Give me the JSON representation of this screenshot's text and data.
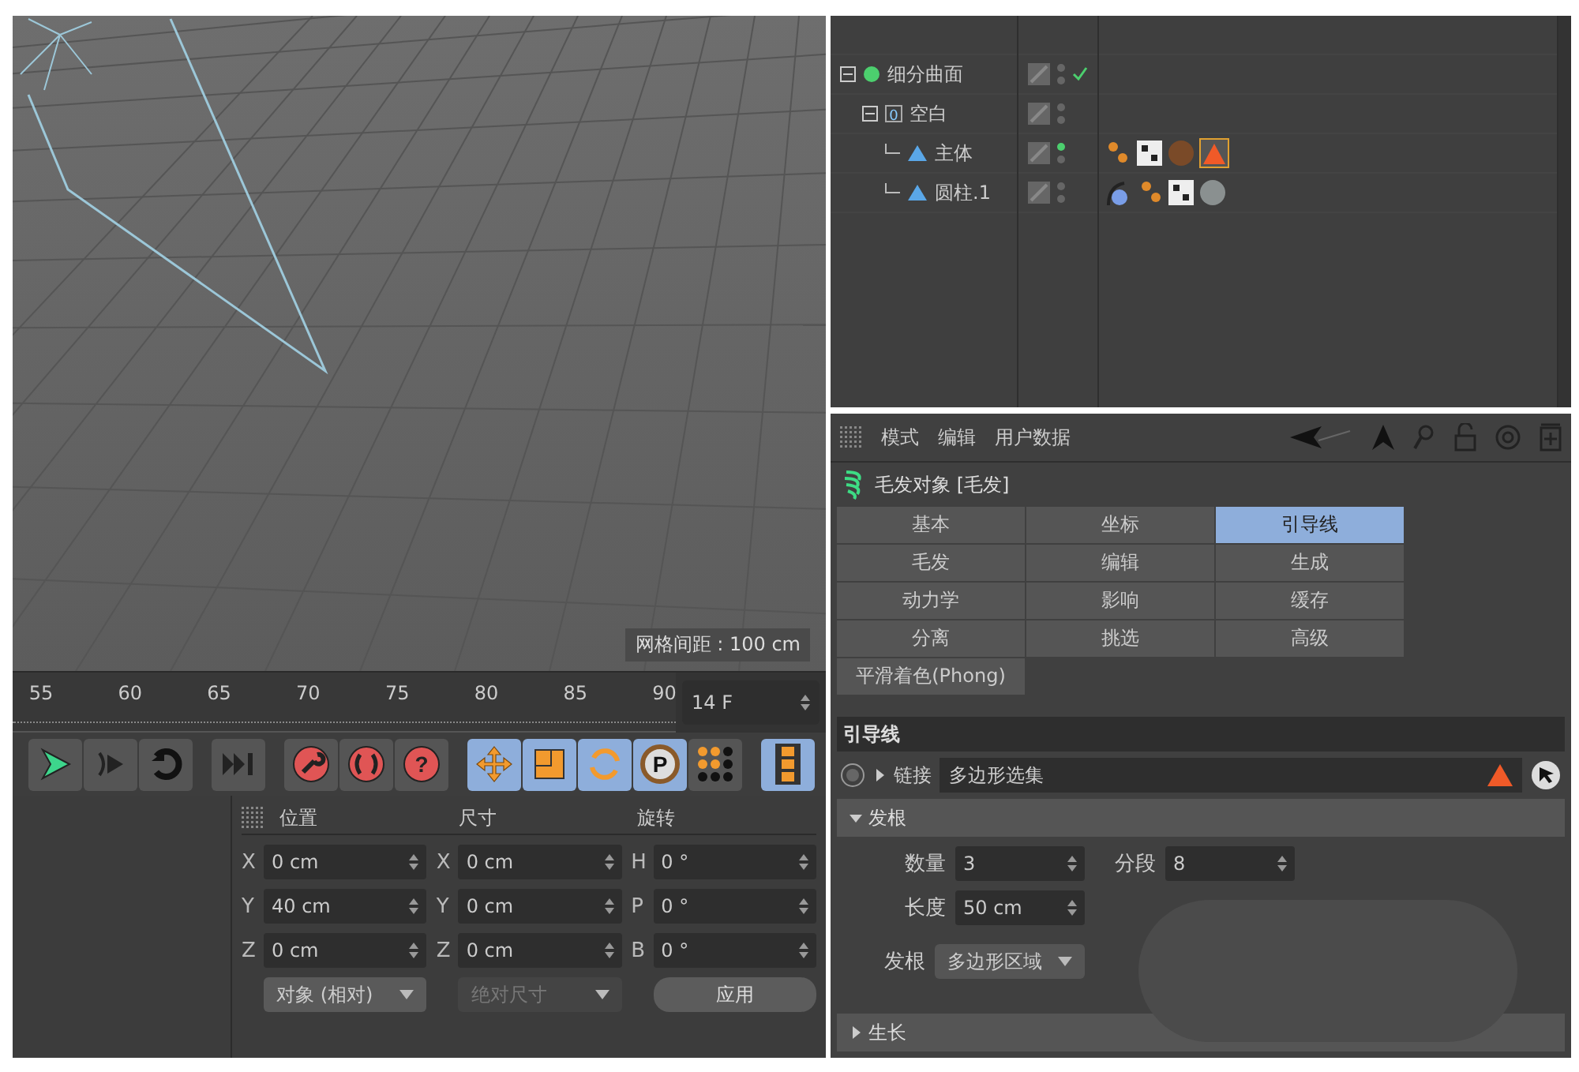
{
  "viewport": {
    "grid_label": "网格间距 : 100 cm"
  },
  "timeline": {
    "ticks": [
      "55",
      "60",
      "65",
      "70",
      "75",
      "80",
      "85",
      "90"
    ],
    "frame_field": "14 F"
  },
  "toolbar": {
    "groups": [
      [
        {
          "kind": "play",
          "on": false
        },
        {
          "kind": "step",
          "on": false
        },
        {
          "kind": "loop",
          "on": false
        }
      ],
      [
        {
          "kind": "end",
          "on": false
        }
      ],
      [
        {
          "kind": "keys",
          "on": false
        },
        {
          "kind": "auto",
          "on": false
        },
        {
          "kind": "help",
          "on": false,
          "glyph": "?"
        }
      ],
      [
        {
          "kind": "move",
          "on": true
        },
        {
          "kind": "scale",
          "on": true
        },
        {
          "kind": "rotate",
          "on": true
        },
        {
          "kind": "param",
          "on": true,
          "glyph": "P"
        },
        {
          "kind": "dots",
          "on": false
        }
      ],
      [
        {
          "kind": "film",
          "on": true
        }
      ]
    ]
  },
  "coordinates": {
    "headers": [
      "位置",
      "尺寸",
      "旋转"
    ],
    "rows": [
      {
        "pos_axis": "X",
        "pos": "0 cm",
        "size_axis": "X",
        "size": "0 cm",
        "rot_axis": "H",
        "rot": "0 °"
      },
      {
        "pos_axis": "Y",
        "pos": "40 cm",
        "size_axis": "Y",
        "size": "0 cm",
        "rot_axis": "P",
        "rot": "0 °"
      },
      {
        "pos_axis": "Z",
        "pos": "0 cm",
        "size_axis": "Z",
        "size": "0 cm",
        "rot_axis": "B",
        "rot": "0 °"
      }
    ],
    "dropdowns": [
      {
        "label": "对象 (相对)",
        "disabled": false
      },
      {
        "label": "绝对尺寸",
        "disabled": true
      }
    ],
    "apply": "应用"
  },
  "objects": [
    {
      "name": "细分曲面",
      "kind": "subdivision",
      "expanded": true,
      "children": [
        {
          "name": "空白",
          "kind": "null",
          "badge": "0",
          "expanded": true,
          "children": [
            {
              "name": "主体",
              "kind": "polygon"
            },
            {
              "name": "圆柱.1",
              "kind": "polygon"
            }
          ]
        }
      ]
    }
  ],
  "attributes": {
    "menu": [
      "模式",
      "编辑",
      "用户数据"
    ],
    "object_title": "毛发对象 [毛发]",
    "tabs": [
      {
        "label": "基本",
        "selected": false
      },
      {
        "label": "坐标",
        "selected": false
      },
      {
        "label": "引导线",
        "selected": true
      },
      {
        "label": "毛发",
        "selected": false
      },
      {
        "label": "编辑",
        "selected": false
      },
      {
        "label": "生成",
        "selected": false
      },
      {
        "label": "动力学",
        "selected": false
      },
      {
        "label": "影响",
        "selected": false
      },
      {
        "label": "缓存",
        "selected": false
      },
      {
        "label": "分离",
        "selected": false
      },
      {
        "label": "挑选",
        "selected": false
      },
      {
        "label": "高级",
        "selected": false
      },
      {
        "label": "平滑着色(Phong)",
        "selected": false
      }
    ],
    "section": "引导线",
    "link": {
      "label": "链接",
      "value": "多边形选集"
    },
    "root_group": {
      "label": "发根",
      "expanded": true
    },
    "fields": [
      {
        "label": "数量",
        "value": "3"
      },
      {
        "label": "分段",
        "value": "8"
      },
      {
        "label": "长度",
        "value": "50 cm"
      }
    ],
    "root_dropdown": {
      "label": "发根",
      "value": "多边形区域"
    },
    "growth_group": {
      "label": "生长",
      "expanded": false
    }
  }
}
